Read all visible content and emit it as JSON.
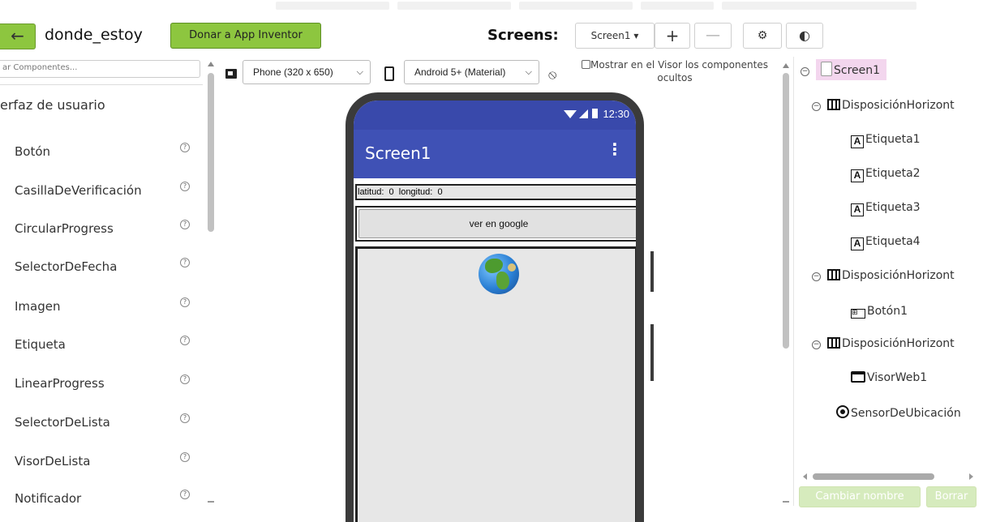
{
  "header": {
    "back_icon": "←",
    "project_name": "donde_estoy",
    "donate_label": "Donar a App Inventor",
    "screens_label": "Screens:",
    "screen_select": "Screen1 ▾",
    "add_screen": "+",
    "remove_screen": "—",
    "project_props_icon": "⚙",
    "language_icon": "◐"
  },
  "palette": {
    "search_placeholder": "ar Componentes...",
    "category": "erfaz de usuario",
    "help_glyph": "?",
    "items": [
      {
        "label": "Botón"
      },
      {
        "label": "CasillaDeVerificación"
      },
      {
        "label": "CircularProgress"
      },
      {
        "label": "SelectorDeFecha"
      },
      {
        "label": "Imagen"
      },
      {
        "label": "Etiqueta"
      },
      {
        "label": "LinearProgress"
      },
      {
        "label": "SelectorDeLista"
      },
      {
        "label": "VisorDeLista"
      },
      {
        "label": "Notificador"
      }
    ]
  },
  "viewer": {
    "size_select": "Phone (320 x 650)",
    "theme_select": "Android 5+ (Material)",
    "chevron": "⌵",
    "hidden_icon": "⦸",
    "show_hidden_label": "Mostrar en el Visor los componentes ocultos",
    "phone": {
      "status_time": "12:30",
      "app_title": "Screen1",
      "menu_glyph": "⋮",
      "label_row": "latitud:  0  longitud:  0",
      "button_text": "ver en google"
    }
  },
  "tree": {
    "collapse_glyph": "−",
    "nodes": [
      {
        "label": "Screen1"
      },
      {
        "label": "DisposiciónHorizont"
      },
      {
        "label": "Etiqueta1"
      },
      {
        "label": "Etiqueta2"
      },
      {
        "label": "Etiqueta3"
      },
      {
        "label": "Etiqueta4"
      },
      {
        "label": "DisposiciónHorizont"
      },
      {
        "label": "Botón1"
      },
      {
        "label": "DisposiciónHorizont"
      },
      {
        "label": "VisorWeb1"
      },
      {
        "label": "SensorDeUbicación"
      }
    ],
    "rename_label": "Cambiar nombre",
    "delete_label": "Borrar",
    "button_icon": "⊞"
  },
  "colors": {
    "accent_green": "#8dc63f",
    "app_bar": "#3f51b5",
    "status_bar": "#3949ab",
    "selected_node": "#f3d6ee"
  }
}
